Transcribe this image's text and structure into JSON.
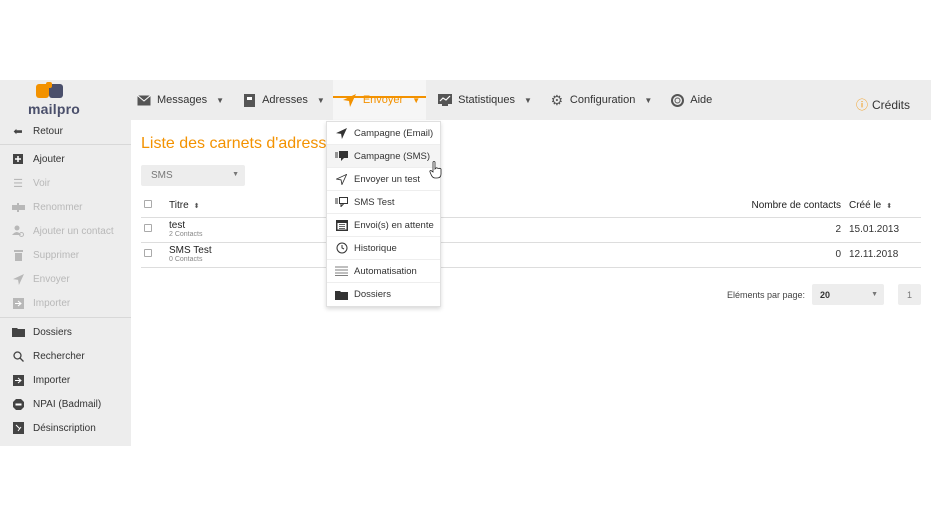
{
  "brand": {
    "name": "mailpro",
    "colors": {
      "accent": "#f39200",
      "navy": "#4a4f6b"
    }
  },
  "nav": [
    {
      "label": "Messages",
      "icon": "envelope-icon"
    },
    {
      "label": "Adresses",
      "icon": "address-book-icon"
    },
    {
      "label": "Envoyer",
      "icon": "paper-plane-icon"
    },
    {
      "label": "Statistiques",
      "icon": "chart-icon"
    },
    {
      "label": "Configuration",
      "icon": "gear-icon"
    },
    {
      "label": "Aide",
      "icon": "lifebuoy-icon"
    }
  ],
  "credits": {
    "label": "Crédits",
    "icon": "info-icon"
  },
  "sidebar": {
    "items": [
      {
        "label": "Retour",
        "icon": "back-arrow-icon"
      },
      {
        "label": "Ajouter",
        "icon": "plus-square-icon"
      },
      {
        "label": "Voir",
        "icon": "list-icon"
      },
      {
        "label": "Renommer",
        "icon": "rename-icon"
      },
      {
        "label": "Ajouter un contact",
        "icon": "add-contact-icon"
      },
      {
        "label": "Supprimer",
        "icon": "trash-icon"
      },
      {
        "label": "Envoyer",
        "icon": "paper-plane-icon"
      },
      {
        "label": "Importer",
        "icon": "import-icon"
      },
      {
        "label": "Dossiers",
        "icon": "folder-icon"
      },
      {
        "label": "Rechercher",
        "icon": "search-icon"
      },
      {
        "label": "Importer",
        "icon": "import-icon"
      },
      {
        "label": "NPAI (Badmail)",
        "icon": "badmail-icon"
      },
      {
        "label": "Désinscription",
        "icon": "unsubscribe-icon"
      }
    ]
  },
  "main": {
    "title": "Liste des carnets d'adresses",
    "filter": {
      "value": "SMS"
    },
    "table": {
      "columns": {
        "title": "Titre",
        "contacts": "Nombre de contacts",
        "created": "Créé le"
      },
      "rows": [
        {
          "name": "test",
          "sub": "2 Contacts",
          "count": "2",
          "date": "15.01.2013"
        },
        {
          "name": "SMS Test",
          "sub": "0 Contacts",
          "count": "0",
          "date": "12.11.2018"
        }
      ]
    },
    "pager": {
      "label": "Eléments par page:",
      "per_page": "20",
      "page": "1"
    }
  },
  "dropdown": {
    "items": [
      {
        "label": "Campagne (Email)",
        "icon": "paper-plane-icon"
      },
      {
        "label": "Campagne (SMS)",
        "icon": "sms-icon"
      },
      {
        "label": "Envoyer un test",
        "icon": "paper-plane-outline-icon"
      },
      {
        "label": "SMS Test",
        "icon": "sms-outline-icon"
      },
      {
        "label": "Envoi(s) en attente",
        "icon": "calendar-icon"
      },
      {
        "label": "Historique",
        "icon": "history-icon"
      },
      {
        "label": "Automatisation",
        "icon": "automation-icon"
      },
      {
        "label": "Dossiers",
        "icon": "folder-icon"
      }
    ]
  }
}
